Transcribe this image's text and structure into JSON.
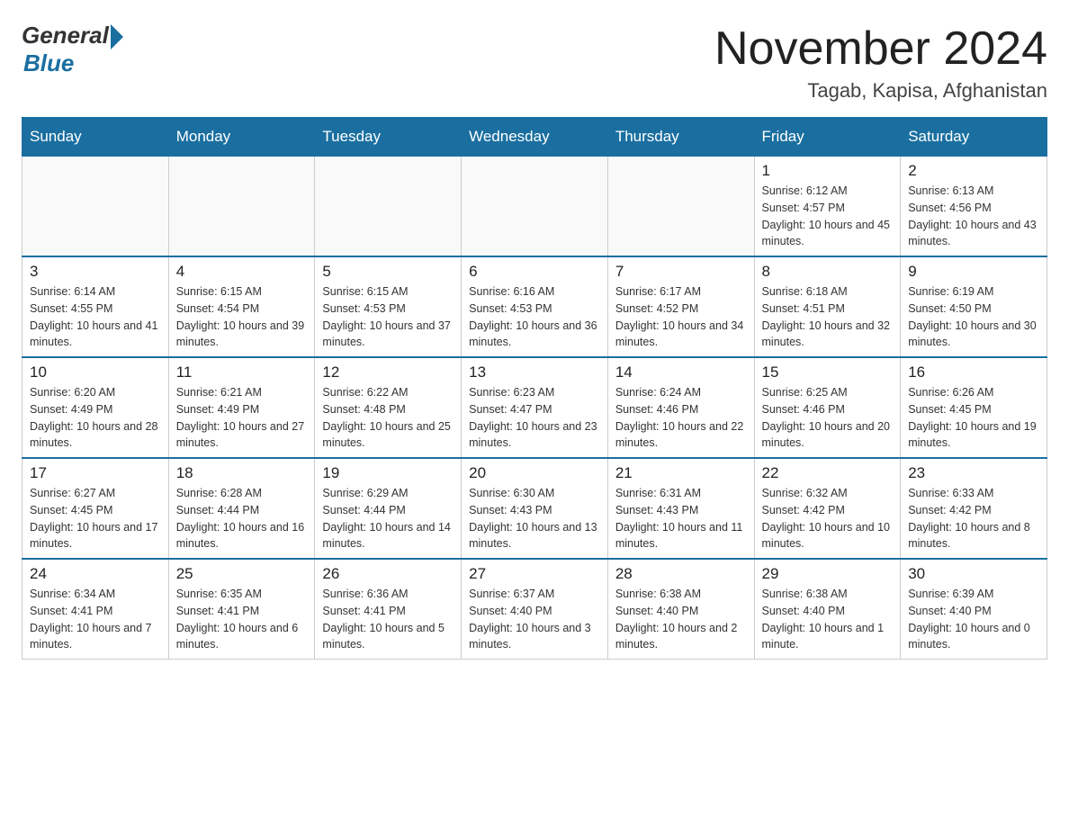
{
  "logo": {
    "general": "General",
    "blue": "Blue"
  },
  "title": "November 2024",
  "location": "Tagab, Kapisa, Afghanistan",
  "weekdays": [
    "Sunday",
    "Monday",
    "Tuesday",
    "Wednesday",
    "Thursday",
    "Friday",
    "Saturday"
  ],
  "weeks": [
    [
      {
        "day": "",
        "info": ""
      },
      {
        "day": "",
        "info": ""
      },
      {
        "day": "",
        "info": ""
      },
      {
        "day": "",
        "info": ""
      },
      {
        "day": "",
        "info": ""
      },
      {
        "day": "1",
        "info": "Sunrise: 6:12 AM\nSunset: 4:57 PM\nDaylight: 10 hours and 45 minutes."
      },
      {
        "day": "2",
        "info": "Sunrise: 6:13 AM\nSunset: 4:56 PM\nDaylight: 10 hours and 43 minutes."
      }
    ],
    [
      {
        "day": "3",
        "info": "Sunrise: 6:14 AM\nSunset: 4:55 PM\nDaylight: 10 hours and 41 minutes."
      },
      {
        "day": "4",
        "info": "Sunrise: 6:15 AM\nSunset: 4:54 PM\nDaylight: 10 hours and 39 minutes."
      },
      {
        "day": "5",
        "info": "Sunrise: 6:15 AM\nSunset: 4:53 PM\nDaylight: 10 hours and 37 minutes."
      },
      {
        "day": "6",
        "info": "Sunrise: 6:16 AM\nSunset: 4:53 PM\nDaylight: 10 hours and 36 minutes."
      },
      {
        "day": "7",
        "info": "Sunrise: 6:17 AM\nSunset: 4:52 PM\nDaylight: 10 hours and 34 minutes."
      },
      {
        "day": "8",
        "info": "Sunrise: 6:18 AM\nSunset: 4:51 PM\nDaylight: 10 hours and 32 minutes."
      },
      {
        "day": "9",
        "info": "Sunrise: 6:19 AM\nSunset: 4:50 PM\nDaylight: 10 hours and 30 minutes."
      }
    ],
    [
      {
        "day": "10",
        "info": "Sunrise: 6:20 AM\nSunset: 4:49 PM\nDaylight: 10 hours and 28 minutes."
      },
      {
        "day": "11",
        "info": "Sunrise: 6:21 AM\nSunset: 4:49 PM\nDaylight: 10 hours and 27 minutes."
      },
      {
        "day": "12",
        "info": "Sunrise: 6:22 AM\nSunset: 4:48 PM\nDaylight: 10 hours and 25 minutes."
      },
      {
        "day": "13",
        "info": "Sunrise: 6:23 AM\nSunset: 4:47 PM\nDaylight: 10 hours and 23 minutes."
      },
      {
        "day": "14",
        "info": "Sunrise: 6:24 AM\nSunset: 4:46 PM\nDaylight: 10 hours and 22 minutes."
      },
      {
        "day": "15",
        "info": "Sunrise: 6:25 AM\nSunset: 4:46 PM\nDaylight: 10 hours and 20 minutes."
      },
      {
        "day": "16",
        "info": "Sunrise: 6:26 AM\nSunset: 4:45 PM\nDaylight: 10 hours and 19 minutes."
      }
    ],
    [
      {
        "day": "17",
        "info": "Sunrise: 6:27 AM\nSunset: 4:45 PM\nDaylight: 10 hours and 17 minutes."
      },
      {
        "day": "18",
        "info": "Sunrise: 6:28 AM\nSunset: 4:44 PM\nDaylight: 10 hours and 16 minutes."
      },
      {
        "day": "19",
        "info": "Sunrise: 6:29 AM\nSunset: 4:44 PM\nDaylight: 10 hours and 14 minutes."
      },
      {
        "day": "20",
        "info": "Sunrise: 6:30 AM\nSunset: 4:43 PM\nDaylight: 10 hours and 13 minutes."
      },
      {
        "day": "21",
        "info": "Sunrise: 6:31 AM\nSunset: 4:43 PM\nDaylight: 10 hours and 11 minutes."
      },
      {
        "day": "22",
        "info": "Sunrise: 6:32 AM\nSunset: 4:42 PM\nDaylight: 10 hours and 10 minutes."
      },
      {
        "day": "23",
        "info": "Sunrise: 6:33 AM\nSunset: 4:42 PM\nDaylight: 10 hours and 8 minutes."
      }
    ],
    [
      {
        "day": "24",
        "info": "Sunrise: 6:34 AM\nSunset: 4:41 PM\nDaylight: 10 hours and 7 minutes."
      },
      {
        "day": "25",
        "info": "Sunrise: 6:35 AM\nSunset: 4:41 PM\nDaylight: 10 hours and 6 minutes."
      },
      {
        "day": "26",
        "info": "Sunrise: 6:36 AM\nSunset: 4:41 PM\nDaylight: 10 hours and 5 minutes."
      },
      {
        "day": "27",
        "info": "Sunrise: 6:37 AM\nSunset: 4:40 PM\nDaylight: 10 hours and 3 minutes."
      },
      {
        "day": "28",
        "info": "Sunrise: 6:38 AM\nSunset: 4:40 PM\nDaylight: 10 hours and 2 minutes."
      },
      {
        "day": "29",
        "info": "Sunrise: 6:38 AM\nSunset: 4:40 PM\nDaylight: 10 hours and 1 minute."
      },
      {
        "day": "30",
        "info": "Sunrise: 6:39 AM\nSunset: 4:40 PM\nDaylight: 10 hours and 0 minutes."
      }
    ]
  ]
}
